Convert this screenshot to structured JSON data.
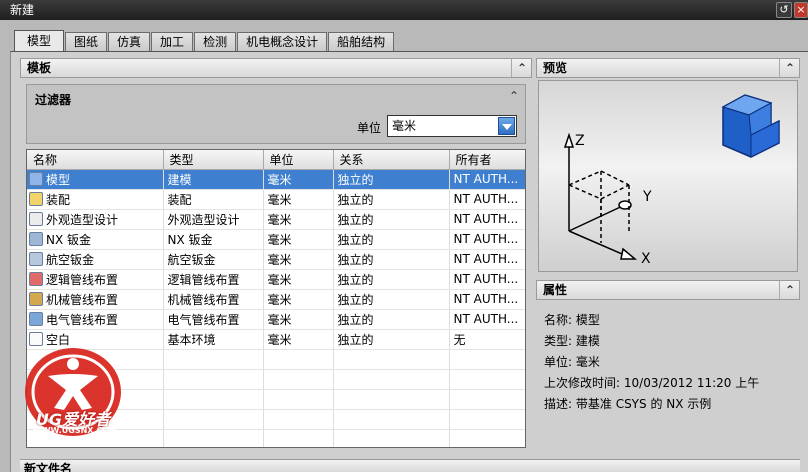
{
  "window": {
    "title": "新建"
  },
  "tabs": [
    "模型",
    "图纸",
    "仿真",
    "加工",
    "检测",
    "机电概念设计",
    "船舶结构"
  ],
  "template_section": {
    "title": "模板"
  },
  "filter": {
    "title": "过滤器",
    "unit_label": "单位",
    "unit_value": "毫米"
  },
  "table": {
    "headers": [
      "名称",
      "类型",
      "单位",
      "关系",
      "所有者"
    ],
    "rows": [
      {
        "name": "模型",
        "type": "建模",
        "unit": "毫米",
        "relation": "独立的",
        "owner": "NT AUTH...",
        "icon": "model-icon"
      },
      {
        "name": "装配",
        "type": "装配",
        "unit": "毫米",
        "relation": "独立的",
        "owner": "NT AUTH...",
        "icon": "assembly-icon"
      },
      {
        "name": "外观造型设计",
        "type": "外观造型设计",
        "unit": "毫米",
        "relation": "独立的",
        "owner": "NT AUTH...",
        "icon": "shape-studio-icon"
      },
      {
        "name": "NX 钣金",
        "type": "NX 钣金",
        "unit": "毫米",
        "relation": "独立的",
        "owner": "NT AUTH...",
        "icon": "sheet-metal-icon"
      },
      {
        "name": "航空钣金",
        "type": "航空钣金",
        "unit": "毫米",
        "relation": "独立的",
        "owner": "NT AUTH...",
        "icon": "aero-sheet-metal-icon"
      },
      {
        "name": "逻辑管线布置",
        "type": "逻辑管线布置",
        "unit": "毫米",
        "relation": "独立的",
        "owner": "NT AUTH...",
        "icon": "logical-routing-icon"
      },
      {
        "name": "机械管线布置",
        "type": "机械管线布置",
        "unit": "毫米",
        "relation": "独立的",
        "owner": "NT AUTH...",
        "icon": "mechanical-routing-icon"
      },
      {
        "name": "电气管线布置",
        "type": "电气管线布置",
        "unit": "毫米",
        "relation": "独立的",
        "owner": "NT AUTH...",
        "icon": "electrical-routing-icon"
      },
      {
        "name": "空白",
        "type": "基本环境",
        "unit": "毫米",
        "relation": "独立的",
        "owner": "无",
        "icon": "blank-icon"
      }
    ]
  },
  "preview": {
    "title": "预览",
    "axis_x": "X",
    "axis_y": "Y",
    "axis_z": "Z"
  },
  "properties": {
    "title": "属性",
    "items": [
      {
        "label": "名称:",
        "value": "模型"
      },
      {
        "label": "类型:",
        "value": "建模"
      },
      {
        "label": "单位:",
        "value": "毫米"
      },
      {
        "label": "上次修改时间:",
        "value": "10/03/2012 11:20 上午"
      },
      {
        "label": "描述:",
        "value": "带基准 CSYS 的 NX 示例"
      }
    ]
  },
  "new_filename": {
    "title": "新文件名"
  },
  "watermark": {
    "brand": "UG爱好者",
    "url": "WWW.UGSNX.COM"
  },
  "colors": {
    "selection": "#3f7fcf",
    "logo_red": "#d8231b"
  }
}
